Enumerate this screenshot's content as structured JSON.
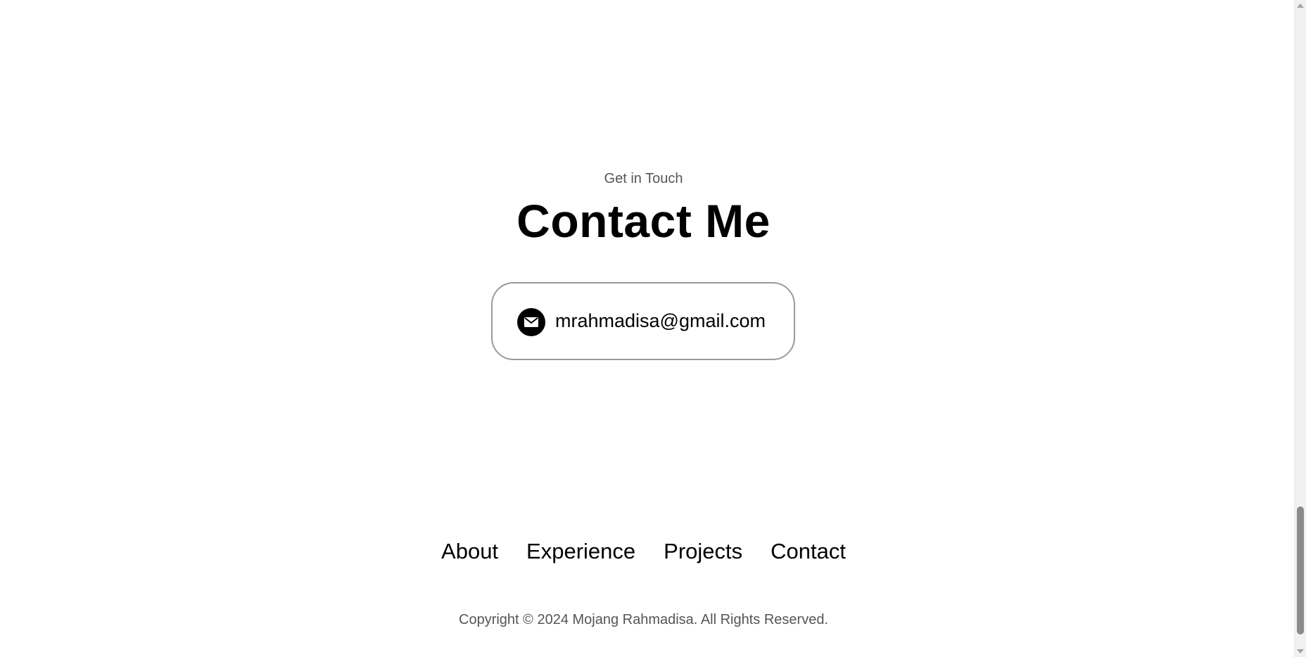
{
  "contact_section": {
    "subtitle": "Get in Touch",
    "title": "Contact Me",
    "email": "mrahmadisa@gmail.com",
    "email_icon": "mail-icon"
  },
  "footer": {
    "nav": [
      {
        "label": "About"
      },
      {
        "label": "Experience"
      },
      {
        "label": "Projects"
      },
      {
        "label": "Contact"
      }
    ],
    "copyright": "Copyright © 2024 Mojang Rahmadisa. All Rights Reserved."
  },
  "scrollbar": {
    "position_fraction": 0.92
  },
  "colors": {
    "text_primary": "#000000",
    "text_secondary": "#555555",
    "card_border": "#9a9a9a",
    "background": "#ffffff"
  }
}
